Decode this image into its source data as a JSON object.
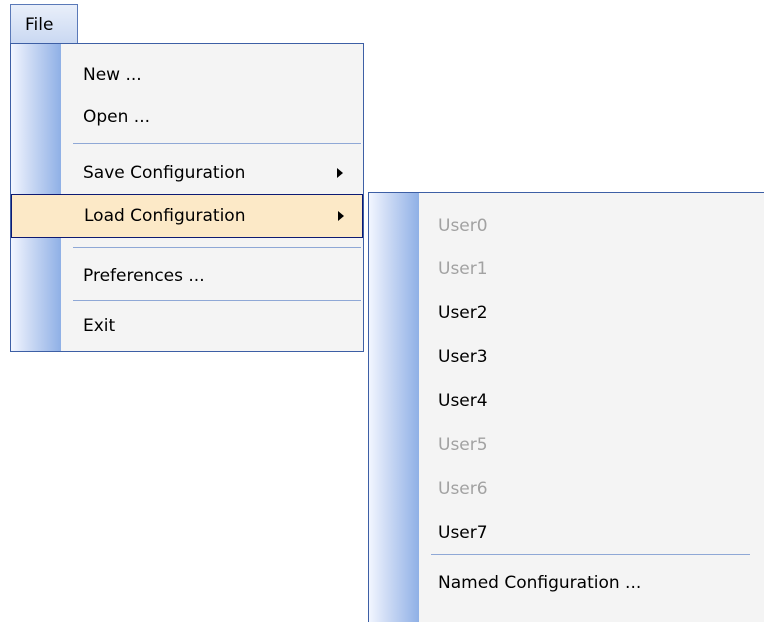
{
  "menubar": {
    "file_label": "File"
  },
  "file_menu": {
    "items": [
      {
        "label": "New ..."
      },
      {
        "label": "Open ..."
      },
      {
        "label": "Save Configuration"
      },
      {
        "label": "Load Configuration"
      },
      {
        "label": "Preferences ..."
      },
      {
        "label": "Exit"
      }
    ]
  },
  "load_submenu": {
    "items": [
      {
        "label": "User0",
        "enabled": false
      },
      {
        "label": "User1",
        "enabled": false
      },
      {
        "label": "User2",
        "enabled": true
      },
      {
        "label": "User3",
        "enabled": true
      },
      {
        "label": "User4",
        "enabled": true
      },
      {
        "label": "User5",
        "enabled": false
      },
      {
        "label": "User6",
        "enabled": false
      },
      {
        "label": "User7",
        "enabled": true
      },
      {
        "label": "Named Configuration ...",
        "enabled": true
      }
    ]
  },
  "colors": {
    "highlight_bg": "#fce9c7",
    "highlight_border": "#0d1a73",
    "menu_border": "#3d5fa5",
    "disabled_text": "#a2a2a2"
  }
}
